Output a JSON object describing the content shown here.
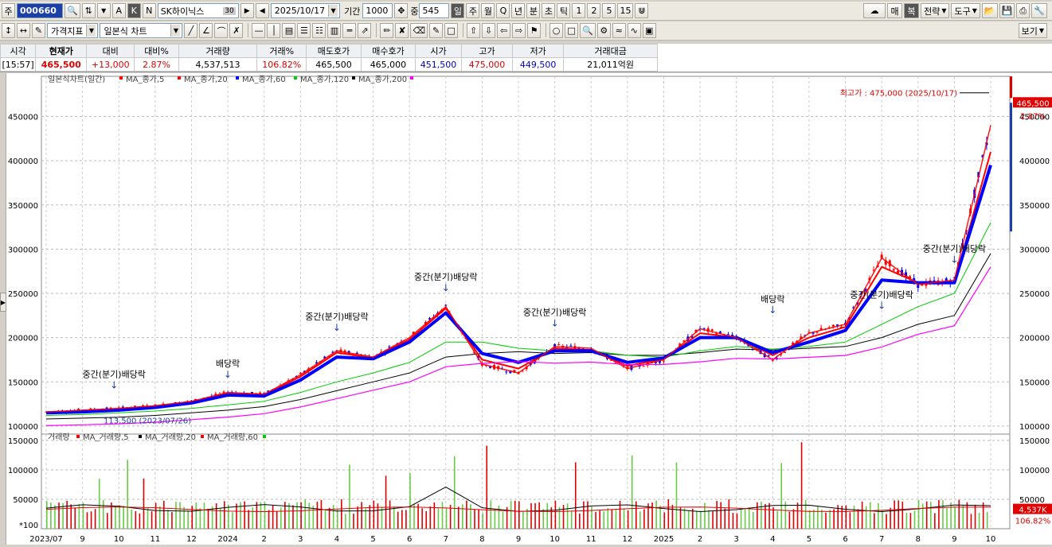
{
  "toolbar1": {
    "market_label": "주",
    "code": "000660",
    "name": "SK하이닉스",
    "name_badge": "30",
    "date": "2025/10/17",
    "period_label": "기간",
    "period_value": "1000",
    "count_label": "중",
    "count_value": "545",
    "cycle_buttons": [
      "일",
      "주",
      "월",
      "Q",
      "년",
      "분",
      "초",
      "틱",
      "1",
      "2",
      "5",
      "15"
    ],
    "active_cycle": "일",
    "btn_a": "A",
    "btn_k": "K",
    "btn_n": "N",
    "right_buttons": [
      "매",
      "복",
      "전략",
      "도구"
    ]
  },
  "toolbar2": {
    "indicator_label": "가격지표",
    "chart_type": "일본식 차트",
    "right_button": "보기"
  },
  "ticker": {
    "headers": [
      "시각",
      "현재가",
      "대비",
      "대비%",
      "거래량",
      "거래%",
      "매도호가",
      "매수호가",
      "시가",
      "고가",
      "저가",
      "거래대금"
    ],
    "values": [
      "[15:57]",
      "465,500",
      "+13,000",
      "2.87%",
      "4,537,513",
      "106.82%",
      "465,500",
      "465,000",
      "451,500",
      "475,000",
      "449,500",
      "21,011억원"
    ]
  },
  "price_legend": {
    "title": "일본식차트(일간)",
    "items": [
      {
        "label": "MA_종가,5",
        "color": "#ff0000"
      },
      {
        "label": "MA_종가,20",
        "color": "#ff0000"
      },
      {
        "label": "MA_종가,60",
        "color": "#0000ff"
      },
      {
        "label": "MA_종가,120",
        "color": "#00cc00"
      },
      {
        "label": "MA_종가,200",
        "color": "#000000"
      }
    ],
    "last_marker_color": "#ff00ff"
  },
  "volume_legend": {
    "title": "거래량",
    "items": [
      {
        "label": "MA_거래량,5",
        "color": "#ff0000"
      },
      {
        "label": "MA_거래량,20",
        "color": "#000000"
      },
      {
        "label": "MA_거래량,60",
        "color": "#ff0000"
      }
    ],
    "last_marker_color": "#00cc00"
  },
  "chart_data": [
    {
      "type": "line",
      "title": "일본식차트(일간)",
      "ylim": [
        90000,
        490000
      ],
      "y_ticks": [
        100000,
        150000,
        200000,
        250000,
        300000,
        350000,
        400000,
        450000
      ],
      "x": [
        "2023/07",
        "9",
        "10",
        "11",
        "12",
        "2024",
        "2",
        "3",
        "4",
        "5",
        "6",
        "7",
        "8",
        "9",
        "10",
        "11",
        "12",
        "2025",
        "2",
        "3",
        "4",
        "5",
        "6",
        "7",
        "8",
        "9",
        "10"
      ],
      "series": [
        {
          "name": "MA_종가,5",
          "color": "#ff0000",
          "values": [
            116000,
            118000,
            120000,
            123000,
            128000,
            138000,
            136000,
            158000,
            185000,
            178000,
            200000,
            235000,
            170000,
            160000,
            190000,
            188000,
            165000,
            175000,
            210000,
            200000,
            175000,
            205000,
            215000,
            290000,
            260000,
            265000,
            440000
          ]
        },
        {
          "name": "MA_종가,20",
          "color": "#ff0000",
          "values": [
            115000,
            117000,
            119000,
            122000,
            127000,
            137000,
            135000,
            156000,
            183000,
            177000,
            198000,
            233000,
            175000,
            165000,
            188000,
            186000,
            168000,
            176000,
            205000,
            200000,
            180000,
            200000,
            212000,
            280000,
            262000,
            262000,
            410000
          ]
        },
        {
          "name": "MA_종가,60",
          "color": "#0000ff",
          "values": [
            115000,
            116000,
            118000,
            121000,
            126000,
            135000,
            134000,
            152000,
            178000,
            176000,
            195000,
            228000,
            182000,
            172000,
            185000,
            185000,
            172000,
            177000,
            200000,
            200000,
            183000,
            195000,
            208000,
            265000,
            262000,
            262000,
            395000
          ]
        },
        {
          "name": "MA_종가,120",
          "color": "#00cc00",
          "values": [
            112000,
            113000,
            115000,
            117000,
            120000,
            124000,
            128000,
            138000,
            150000,
            160000,
            172000,
            195000,
            195000,
            188000,
            185000,
            185000,
            180000,
            178000,
            185000,
            190000,
            187000,
            190000,
            195000,
            215000,
            235000,
            250000,
            330000
          ]
        },
        {
          "name": "MA_종가,200",
          "color": "#000000",
          "values": [
            108000,
            109000,
            110000,
            112000,
            115000,
            118000,
            122000,
            130000,
            140000,
            150000,
            160000,
            178000,
            182000,
            184000,
            182000,
            183000,
            180000,
            180000,
            183000,
            187000,
            186000,
            188000,
            190000,
            200000,
            215000,
            225000,
            295000
          ]
        }
      ],
      "annotations": [
        {
          "text": "중간(분기)배당락",
          "x": "10",
          "y": 130000
        },
        {
          "text": "배당락",
          "x": "2024",
          "y": 142000
        },
        {
          "text": "중간(분기)배당락",
          "x": "4",
          "y": 195000
        },
        {
          "text": "중간(분기)배당락",
          "x": "7",
          "y": 240000
        },
        {
          "text": "중간(분기)배당락",
          "x": "10",
          "y": 200000
        },
        {
          "text": "배당락",
          "x": "3",
          "y": 215000
        },
        {
          "text": "중간(분기)배당락",
          "x": "6",
          "y": 220000
        },
        {
          "text": "중간(분기)배당락",
          "x": "9",
          "y": 272000
        }
      ],
      "high_label": "최고가 : 475,000 (2025/10/17)",
      "low_label": "113,500 (2023/07/26)",
      "current_price": "465,500",
      "current_pct": "2.87%"
    },
    {
      "type": "bar",
      "title": "거래량",
      "ylim": [
        0,
        150000
      ],
      "y_ticks": [
        50000,
        100000,
        150000
      ],
      "unit": "*100",
      "current_volume": "4,537K",
      "current_pct": "106.82%"
    }
  ]
}
